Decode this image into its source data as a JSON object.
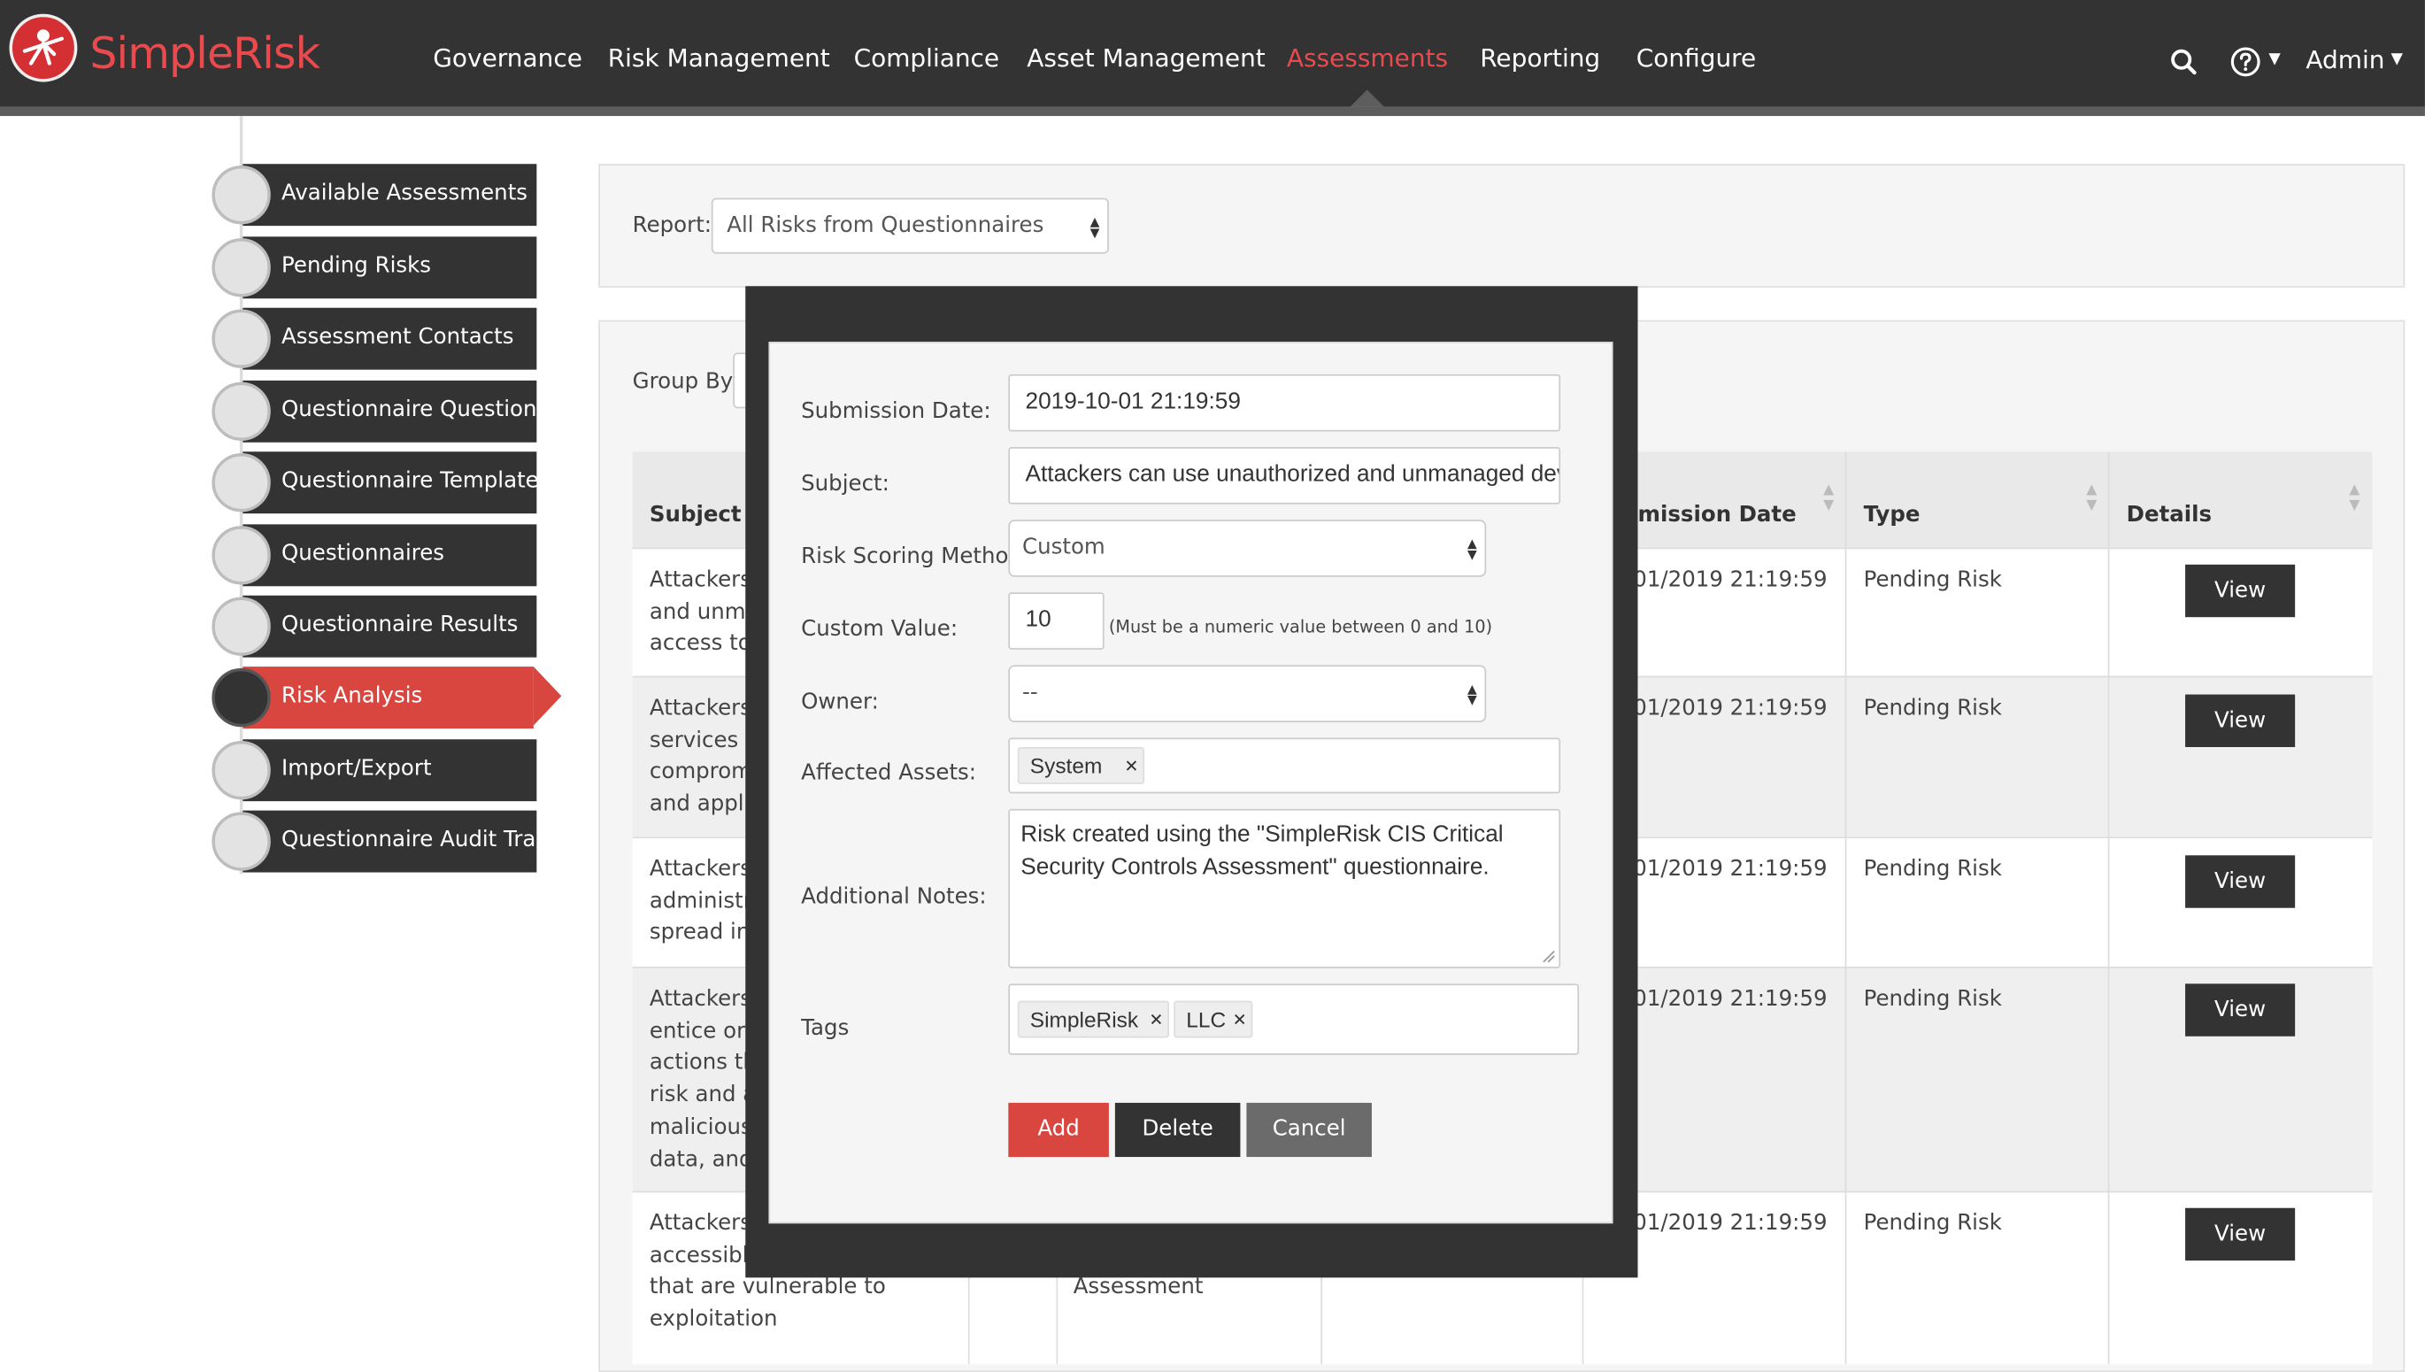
{
  "brand": {
    "name": "SimpleRisk",
    "accent": "#d9453f"
  },
  "nav": {
    "items": [
      "Governance",
      "Risk Management",
      "Compliance",
      "Asset Management",
      "Assessments",
      "Reporting",
      "Configure"
    ],
    "active": "Assessments",
    "user": "Admin",
    "icons": [
      "search-icon",
      "help-icon",
      "caret-down-icon"
    ]
  },
  "sidebar": {
    "items": [
      "Available Assessments",
      "Pending Risks",
      "Assessment Contacts",
      "Questionnaire Questions",
      "Questionnaire Templates",
      "Questionnaires",
      "Questionnaire Results",
      "Risk Analysis",
      "Import/Export",
      "Questionnaire Audit Trail"
    ],
    "active": "Risk Analysis"
  },
  "report": {
    "label": "Report:",
    "selected": "All Risks from Questionnaires"
  },
  "groupby": {
    "label": "Group By:"
  },
  "table": {
    "columns": [
      "Subject",
      "mission Date",
      "Type",
      "Details"
    ],
    "rows": [
      {
        "subject": [
          "Attackers",
          "and unma",
          "access to"
        ],
        "date": "01/2019 21:19:59",
        "type": "Pending Risk",
        "action": "View"
      },
      {
        "subject": [
          "Attackers",
          "services a",
          "comprom",
          "and applic"
        ],
        "date": "01/2019 21:19:59",
        "type": "Pending Risk",
        "action": "View"
      },
      {
        "subject": [
          "Attackers",
          "administra",
          "spread ins"
        ],
        "date": "01/2019 21:19:59",
        "type": "Pending Risk",
        "action": "View"
      },
      {
        "subject": [
          "Attackers",
          "entice or s",
          "actions th",
          "risk and al",
          "malicious",
          "data, and"
        ],
        "date": "01/2019 21:19:59",
        "type": "Pending Risk",
        "action": "View"
      },
      {
        "subject": [
          "Attackers",
          "accessible",
          "that are vulnerable to",
          "exploitation"
        ],
        "middle": "Assessment",
        "date": "01/2019 21:19:59",
        "type": "Pending Risk",
        "action": "View"
      }
    ]
  },
  "modal": {
    "submission_date": {
      "label": "Submission Date:",
      "value": "2019-10-01 21:19:59"
    },
    "subject": {
      "label": "Subject:",
      "value": "Attackers can use unauthorized and unmanaged devices"
    },
    "scoring": {
      "label": "Risk Scoring Method:",
      "value": "Custom"
    },
    "custom_value": {
      "label": "Custom Value:",
      "value": "10",
      "hint": "(Must be a numeric value between 0 and 10)"
    },
    "owner": {
      "label": "Owner:",
      "value": "--"
    },
    "assets": {
      "label": "Affected Assets:",
      "chips": [
        "System"
      ]
    },
    "notes": {
      "label": "Additional Notes:",
      "lines": [
        "Risk created using the \"SimpleRisk CIS Critical",
        "Security Controls Assessment\" questionnaire."
      ]
    },
    "tags": {
      "label": "Tags",
      "chips": [
        "SimpleRisk",
        "LLC"
      ]
    },
    "buttons": {
      "add": "Add",
      "delete": "Delete",
      "cancel": "Cancel"
    }
  }
}
